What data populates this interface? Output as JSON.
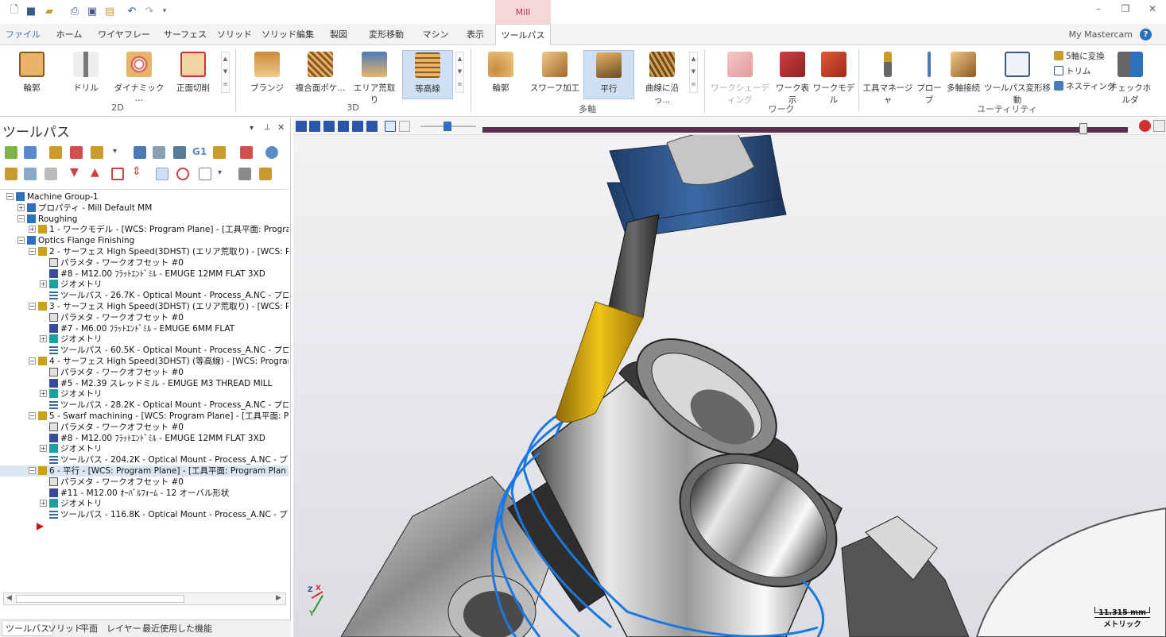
{
  "app": {
    "context_tab": "Mill"
  },
  "menu": {
    "tabs": [
      "ファイル",
      "ホーム",
      "ワイヤフレーム",
      "サーフェス",
      "ソリッド",
      "ソリッド編集",
      "製図",
      "変形移動",
      "マシン",
      "表示",
      "ツールパス"
    ],
    "active": "ツールパス",
    "my_mastercam": "My Mastercam",
    "help": "?"
  },
  "ribbon": {
    "group_2d": {
      "label": "2D",
      "buttons": [
        "輪郭",
        "ドリル",
        "ダイナミック ...",
        "正面切削"
      ]
    },
    "group_3d": {
      "label": "3D",
      "buttons": [
        "ブランジ",
        "複合面ポケ...",
        "エリア荒取り",
        "等高線"
      ]
    },
    "group_multi": {
      "label": "多軸",
      "buttons": [
        "輪郭",
        "スワーフ加工",
        "平行",
        "曲線に沿っ..."
      ]
    },
    "group_work": {
      "label": "ワーク",
      "buttons": [
        "ワークシェーディング",
        "ワーク表示",
        "ワークモデル"
      ]
    },
    "group_util": {
      "label": "ユーティリティ",
      "buttons": [
        "工具マネージャ",
        "プローブ",
        "多軸接続",
        "ツールパス変形移動",
        "チェックホルダ"
      ],
      "small": [
        "5軸に変換",
        "トリム",
        "ネスティング"
      ]
    }
  },
  "panel": {
    "title": "ツールパス",
    "tree": [
      "Machine Group-1",
      "プロパティ - Mill Default MM",
      "Roughing",
      "1 - ワークモデル - [WCS: Program Plane] - [工具平面: Program",
      "Optics Flange Finishing",
      "2 - サーフェス High Speed(3DHST) (エリア荒取り) - [WCS: Program",
      "パラメタ - ワークオフセット #0",
      "#8 - M12.00 ﾌﾗｯﾄｴﾝﾄﾞﾐﾙ - EMUGE 12MM FLAT 3XD",
      "ジオメトリ",
      "ツールパス - 26.7K - Optical Mount - Process_A.NC - プロ",
      "3 - サーフェス High Speed(3DHST) (エリア荒取り) - [WCS: Program",
      "パラメタ - ワークオフセット #0",
      "#7 - M6.00 ﾌﾗｯﾄｴﾝﾄﾞﾐﾙ - EMUGE 6MM FLAT",
      "ジオメトリ",
      "ツールパス - 60.5K - Optical Mount - Process_A.NC - プロ",
      "4 - サーフェス High Speed(3DHST) (等高線) - [WCS: Program F",
      "パラメタ - ワークオフセット #0",
      "#5 - M2.39 スレッドミル - EMUGE M3 THREAD MILL",
      "ジオメトリ",
      "ツールパス - 28.2K - Optical Mount - Process_A.NC - プロ",
      "5 - Swarf machining - [WCS: Program Plane] - [工具平面: P",
      "パラメタ - ワークオフセット #0",
      "#8 - M12.00 ﾌﾗｯﾄｴﾝﾄﾞﾐﾙ - EMUGE 12MM FLAT 3XD",
      "ジオメトリ",
      "ツールパス - 204.2K - Optical Mount - Process_A.NC - プロ",
      "6 - 平行 - [WCS: Program Plane] - [工具平面: Program Plan",
      "パラメタ - ワークオフセット #0",
      "#11 - M12.00 ｵｰﾊﾞﾙﾌｫｰﾑ - 12 オーバル形状",
      "ジオメトリ",
      "ツールパス - 116.8K - Optical Mount - Process_A.NC - プロ"
    ],
    "bottom_tabs": [
      "ツールパス",
      "ソリッド",
      "平面",
      "レイヤー",
      "最近使用した機能"
    ]
  },
  "viewport": {
    "scale_value": "11.315 mm",
    "scale_unit": "メトリック",
    "axis_x": "X",
    "axis_y": "Y",
    "axis_z": "Z"
  }
}
